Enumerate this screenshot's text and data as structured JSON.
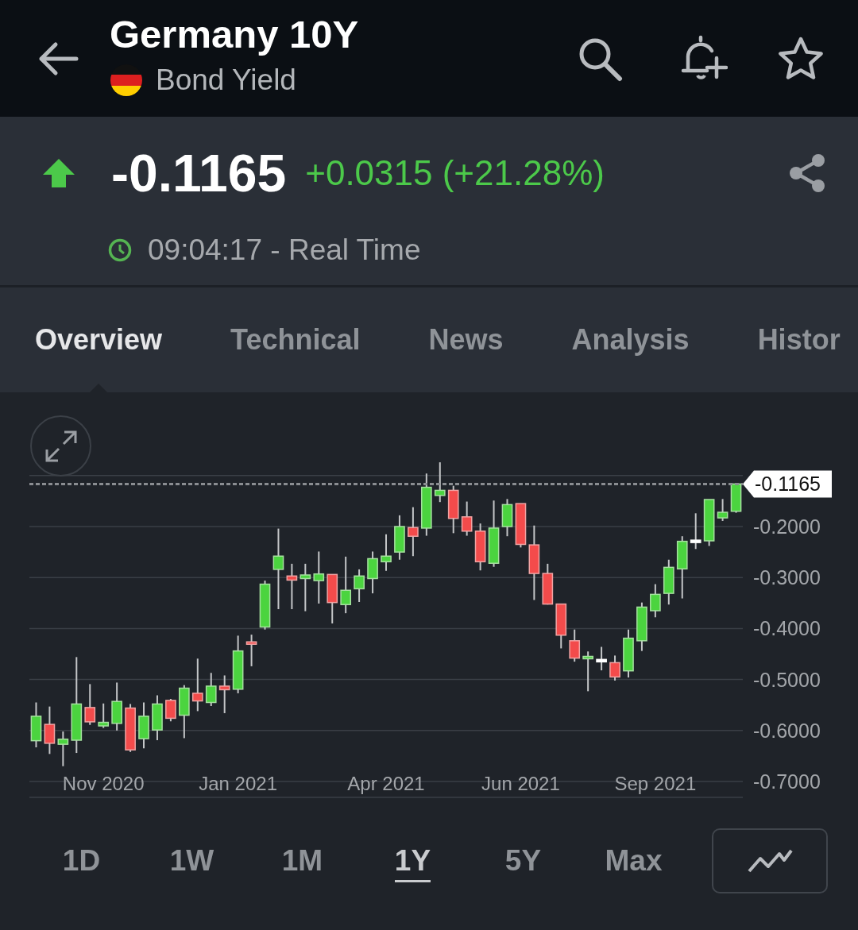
{
  "header": {
    "title": "Germany 10Y",
    "subtitle": "Bond Yield"
  },
  "quote": {
    "last": "-0.1165",
    "change": "+0.0315 (+21.28%)",
    "rising": true,
    "time": "09:04:17 - Real Time"
  },
  "tabs": [
    {
      "label": "Overview",
      "selected": true
    },
    {
      "label": "Technical",
      "selected": false
    },
    {
      "label": "News",
      "selected": false
    },
    {
      "label": "Analysis",
      "selected": false
    },
    {
      "label": "Histor",
      "selected": false
    }
  ],
  "chart": {
    "chart_data": {
      "type": "candlestick",
      "grid": true,
      "ylim": [
        -0.7,
        -0.1
      ],
      "ref_lines": [
        {
          "axis": "y",
          "value": -0.1165,
          "label": "-0.1165"
        }
      ],
      "categories": [
        null,
        null,
        null,
        null,
        null,
        "Nov 2020",
        null,
        null,
        null,
        null,
        null,
        null,
        null,
        null,
        null,
        "Jan 2021",
        null,
        null,
        null,
        null,
        null,
        null,
        null,
        null,
        null,
        null,
        "Apr 2021",
        null,
        null,
        null,
        null,
        null,
        null,
        null,
        null,
        null,
        "Jun 2021",
        null,
        null,
        null,
        null,
        null,
        null,
        null,
        null,
        null,
        "Sep 2021",
        null,
        null,
        null,
        null,
        null,
        null
      ],
      "yticks": [
        {
          "value": -0.2,
          "label": "-0.2000"
        },
        {
          "value": -0.3,
          "label": "-0.3000"
        },
        {
          "value": -0.4,
          "label": "-0.4000"
        },
        {
          "value": -0.5,
          "label": "-0.5000"
        },
        {
          "value": -0.6,
          "label": "-0.6000"
        },
        {
          "value": -0.7,
          "label": "-0.7000"
        }
      ],
      "ohlc": [
        [
          -0.62,
          -0.545,
          -0.633,
          -0.572
        ],
        [
          -0.588,
          -0.553,
          -0.646,
          -0.625
        ],
        [
          -0.627,
          -0.602,
          -0.67,
          -0.617
        ],
        [
          -0.619,
          -0.456,
          -0.644,
          -0.548
        ],
        [
          -0.555,
          -0.509,
          -0.589,
          -0.583
        ],
        [
          -0.591,
          -0.547,
          -0.595,
          -0.584
        ],
        [
          -0.586,
          -0.506,
          -0.6,
          -0.543
        ],
        [
          -0.556,
          -0.548,
          -0.642,
          -0.638
        ],
        [
          -0.616,
          -0.545,
          -0.635,
          -0.572
        ],
        [
          -0.599,
          -0.531,
          -0.619,
          -0.548
        ],
        [
          -0.541,
          -0.538,
          -0.582,
          -0.576
        ],
        [
          -0.57,
          -0.511,
          -0.615,
          -0.517
        ],
        [
          -0.527,
          -0.459,
          -0.562,
          -0.542
        ],
        [
          -0.545,
          -0.487,
          -0.552,
          -0.513
        ],
        [
          -0.513,
          -0.492,
          -0.566,
          -0.52
        ],
        [
          -0.519,
          -0.414,
          -0.527,
          -0.444
        ],
        [
          -0.427,
          -0.412,
          -0.474,
          -0.43
        ],
        [
          -0.397,
          -0.306,
          -0.402,
          -0.313
        ],
        [
          -0.284,
          -0.204,
          -0.362,
          -0.258
        ],
        [
          -0.297,
          -0.273,
          -0.362,
          -0.305
        ],
        [
          -0.302,
          -0.273,
          -0.366,
          -0.295
        ],
        [
          -0.306,
          -0.249,
          -0.351,
          -0.293
        ],
        [
          -0.294,
          -0.294,
          -0.39,
          -0.349
        ],
        [
          -0.353,
          -0.259,
          -0.37,
          -0.325
        ],
        [
          -0.322,
          -0.284,
          -0.348,
          -0.297
        ],
        [
          -0.302,
          -0.249,
          -0.331,
          -0.263
        ],
        [
          -0.269,
          -0.215,
          -0.287,
          -0.258
        ],
        [
          -0.25,
          -0.178,
          -0.265,
          -0.2
        ],
        [
          -0.202,
          -0.162,
          -0.258,
          -0.219
        ],
        [
          -0.203,
          -0.096,
          -0.218,
          -0.123
        ],
        [
          -0.139,
          -0.074,
          -0.152,
          -0.129
        ],
        [
          -0.129,
          -0.12,
          -0.213,
          -0.184
        ],
        [
          -0.181,
          -0.151,
          -0.218,
          -0.209
        ],
        [
          -0.209,
          -0.194,
          -0.286,
          -0.269
        ],
        [
          -0.272,
          -0.149,
          -0.279,
          -0.203
        ],
        [
          -0.2,
          -0.146,
          -0.219,
          -0.157
        ],
        [
          -0.155,
          -0.155,
          -0.241,
          -0.235
        ],
        [
          -0.236,
          -0.198,
          -0.344,
          -0.292
        ],
        [
          -0.292,
          -0.273,
          -0.353,
          -0.352
        ],
        [
          -0.352,
          -0.352,
          -0.439,
          -0.413
        ],
        [
          -0.424,
          -0.402,
          -0.465,
          -0.458
        ],
        [
          -0.459,
          -0.445,
          -0.523,
          -0.455
        ],
        [
          -0.463,
          -0.436,
          -0.482,
          -0.463
        ],
        [
          -0.467,
          -0.453,
          -0.502,
          -0.495
        ],
        [
          -0.483,
          -0.402,
          -0.496,
          -0.419
        ],
        [
          -0.424,
          -0.349,
          -0.444,
          -0.358
        ],
        [
          -0.365,
          -0.313,
          -0.378,
          -0.333
        ],
        [
          -0.331,
          -0.265,
          -0.353,
          -0.28
        ],
        [
          -0.283,
          -0.219,
          -0.341,
          -0.229
        ],
        [
          -0.229,
          -0.174,
          -0.244,
          -0.229
        ],
        [
          -0.228,
          -0.147,
          -0.238,
          -0.147
        ],
        [
          -0.183,
          -0.146,
          -0.189,
          -0.172
        ],
        [
          -0.17,
          -0.115,
          -0.173,
          -0.1165
        ]
      ]
    }
  },
  "ranges": [
    {
      "label": "1D",
      "selected": false
    },
    {
      "label": "1W",
      "selected": false
    },
    {
      "label": "1M",
      "selected": false
    },
    {
      "label": "1Y",
      "selected": true
    },
    {
      "label": "5Y",
      "selected": false
    },
    {
      "label": "Max",
      "selected": false
    }
  ]
}
